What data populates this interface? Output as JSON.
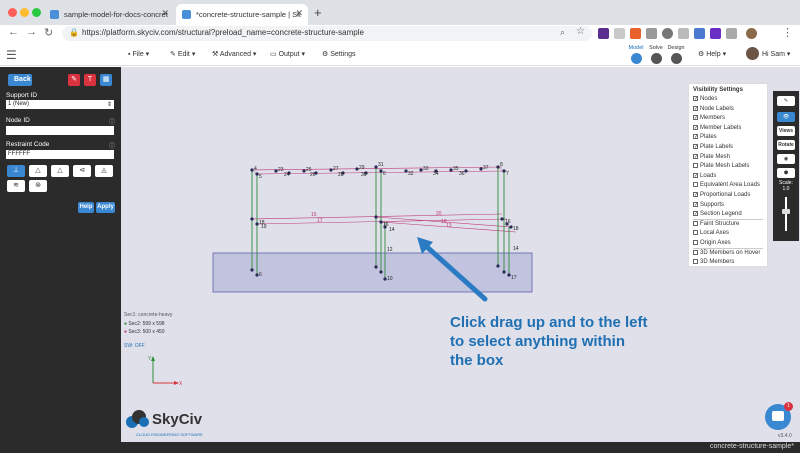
{
  "browser": {
    "tabs": [
      {
        "title": "sample-model-for-docs-concret"
      },
      {
        "title": "*concrete-structure-sample | Sk"
      }
    ],
    "url": "https://platform.skyciv.com/structural?preload_name=concrete-structure-sample"
  },
  "header": {
    "menus": [
      "File",
      "Edit",
      "Advanced",
      "Output",
      "Settings"
    ],
    "modes": [
      "Model",
      "Solve",
      "Design"
    ],
    "help": "Help",
    "user": "Hi Sam"
  },
  "sidebar": {
    "back": "Back",
    "support_id_label": "Support ID",
    "support_id_value": "1 (New)",
    "node_id_label": "Node ID",
    "node_id_value": "",
    "restraint_label": "Restraint Code",
    "restraint_value": "FFFFFF",
    "help": "Help",
    "apply": "Apply"
  },
  "visibility": {
    "title": "Visibility Settings",
    "items": [
      {
        "label": "Nodes",
        "checked": true
      },
      {
        "label": "Node Labels",
        "checked": true
      },
      {
        "label": "Members",
        "checked": true
      },
      {
        "label": "Member Labels",
        "checked": true
      },
      {
        "label": "Plates",
        "checked": true
      },
      {
        "label": "Plate Labels",
        "checked": true
      },
      {
        "label": "Plate Mesh",
        "checked": true
      },
      {
        "label": "Plate Mesh Labels",
        "checked": false
      },
      {
        "label": "Loads",
        "checked": true
      },
      {
        "label": "Equivalent Area Loads",
        "checked": false
      },
      {
        "label": "Proportional Loads",
        "checked": true
      },
      {
        "label": "Supports",
        "checked": true
      },
      {
        "label": "Section Legend",
        "checked": true
      },
      {
        "label": "Faint Structure",
        "checked": false
      },
      {
        "label": "Local Axes",
        "checked": false
      },
      {
        "label": "Origin Axes",
        "checked": false
      },
      {
        "label": "3D Members on Hover",
        "checked": false
      },
      {
        "label": "3D Members",
        "checked": false
      }
    ]
  },
  "right_tools": {
    "views": "Views",
    "rotate": "Rotate",
    "scale_label": "Scale:",
    "scale_value": "1.0"
  },
  "canvas": {
    "legend": [
      "Sec1: concrete-heavy",
      "Sec2: 599 x 598",
      "Sec3: 500 x 450"
    ],
    "legend_colors": [
      "#888888",
      "#2e8b3a",
      "#c0387a"
    ],
    "sw": "SW: OFF",
    "version": "v3.4.0",
    "node_labels": [
      "4",
      "5",
      "23",
      "24",
      "25",
      "26",
      "27",
      "28",
      "29",
      "30",
      "31",
      "32",
      "33",
      "34",
      "35",
      "36",
      "37",
      "8",
      "7",
      "6",
      "16",
      "17",
      "18",
      "19",
      "12",
      "13",
      "14",
      "15",
      "9",
      "10",
      "11"
    ],
    "annotation": "Click drag up and to the left to select anything within the box"
  },
  "logo": {
    "name": "SkyCiv",
    "tagline": "CLOUD ENGINEERING SOFTWARE"
  },
  "status": {
    "title": "concrete-structure-sample*"
  },
  "chat_badge": "1"
}
